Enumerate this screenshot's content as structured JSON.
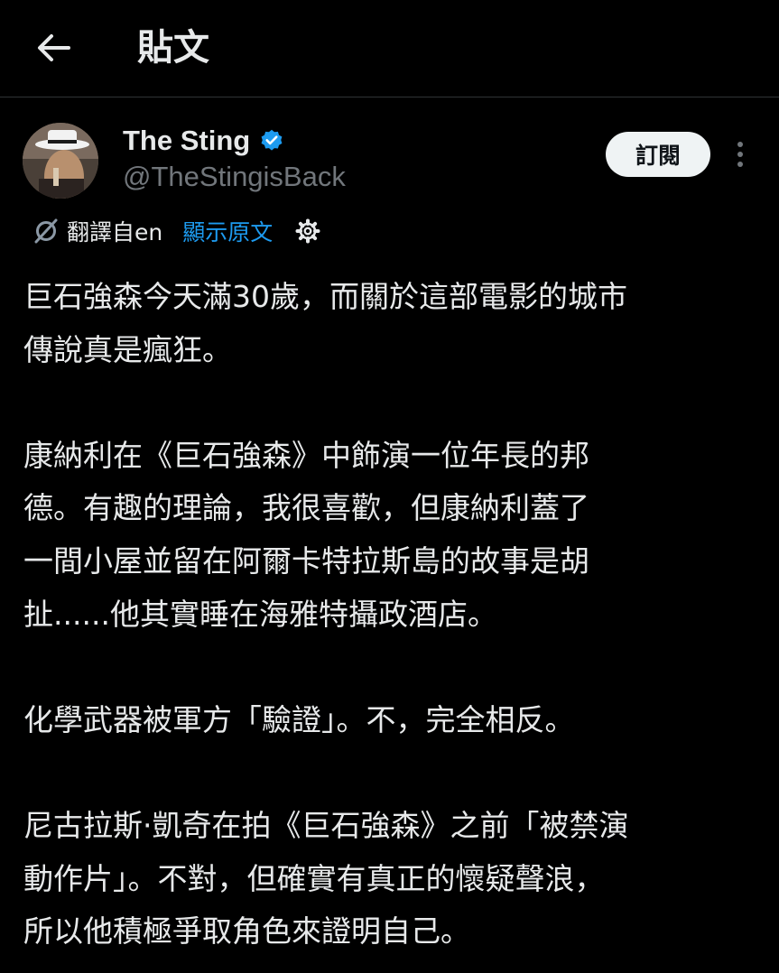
{
  "header": {
    "back_icon": "arrow-left-icon",
    "title": "貼文"
  },
  "author": {
    "avatar_icon": "profile-photo",
    "name": "The Sting",
    "verified_icon": "verified-badge-icon",
    "verified_color": "#1d9bf0",
    "handle": "@TheStingisBack",
    "subscribe_label": "訂閱",
    "more_icon": "more-vertical-icon"
  },
  "translation": {
    "icon": "translate-icon",
    "label": "翻譯自en",
    "show_original": "顯示原文",
    "settings_icon": "gear-icon"
  },
  "tweet": {
    "paragraphs": [
      [
        "巨石強森今天滿30歲，而關於這部電影的城市",
        "傳說真是瘋狂。"
      ],
      [
        "康納利在《巨石強森》中飾演一位年長的邦",
        "德。有趣的理論，我很喜歡，但康納利蓋了",
        "一間小屋並留在阿爾卡特拉斯島的故事是胡",
        "扯......他其實睡在海雅特攝政酒店。"
      ],
      [
        "化學武器被軍方「驗證」。不，完全相反。"
      ],
      [
        "尼古拉斯·凱奇在拍《巨石強森》之前「被禁演",
        "動作片」。不對，但確實有真正的懷疑聲浪，",
        "所以他積極爭取角色來證明自己。"
      ]
    ]
  },
  "colors": {
    "background": "#000000",
    "text": "#e7e9ea",
    "secondary_text": "#71767b",
    "link": "#1d9bf0"
  }
}
